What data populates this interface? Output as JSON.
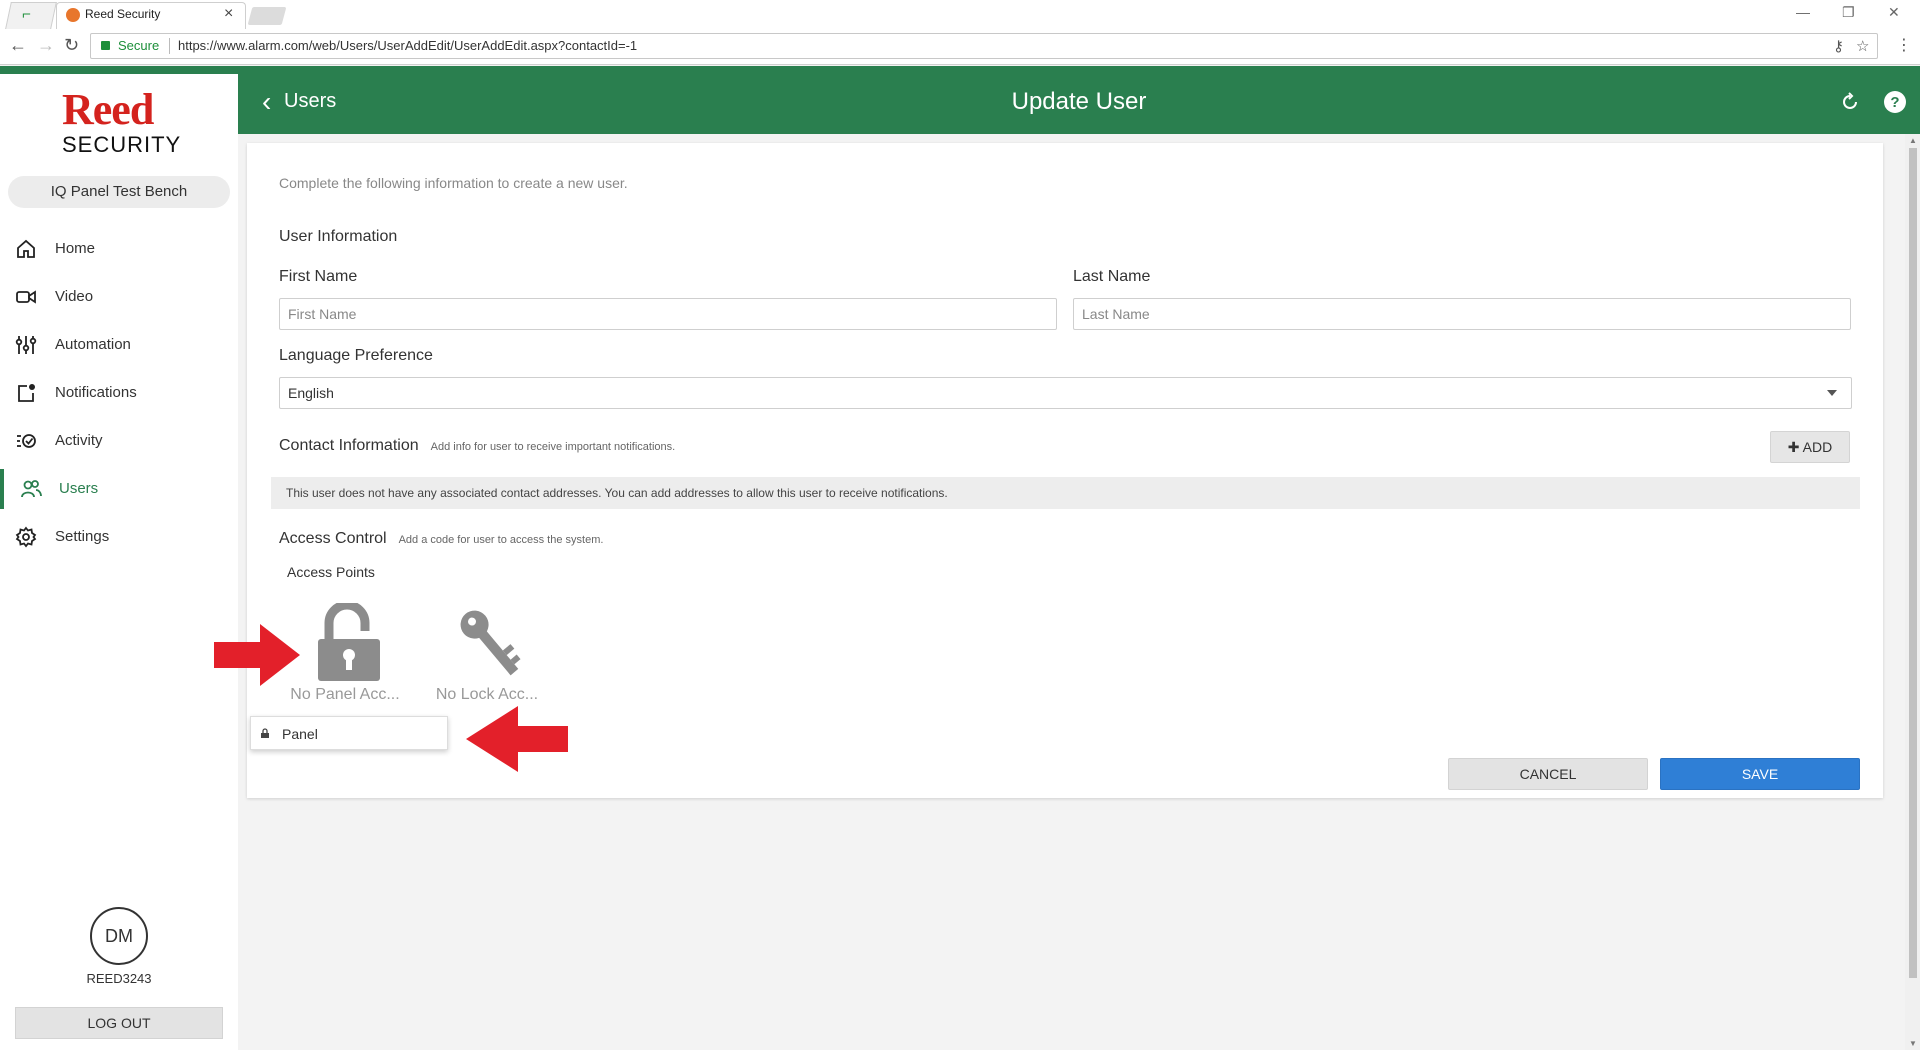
{
  "browser": {
    "tab_title": "Reed Security",
    "secure_label": "Secure",
    "url": "https://www.alarm.com/web/Users/UserAddEdit/UserAddEdit.aspx?contactId=-1"
  },
  "brand": {
    "logo_line1": "Reed",
    "logo_line2": "SECURITY",
    "accent": "#2a7f4f",
    "logo_red": "#d4231e",
    "save_blue": "#2f7fd6"
  },
  "sidebar": {
    "site_name": "IQ Panel Test Bench",
    "items": [
      {
        "label": "Home",
        "icon": "home-icon"
      },
      {
        "label": "Video",
        "icon": "video-camera-icon"
      },
      {
        "label": "Automation",
        "icon": "sliders-icon"
      },
      {
        "label": "Notifications",
        "icon": "notification-icon"
      },
      {
        "label": "Activity",
        "icon": "activity-icon"
      },
      {
        "label": "Users",
        "icon": "users-icon",
        "active": true
      },
      {
        "label": "Settings",
        "icon": "gear-icon"
      }
    ],
    "avatar_initials": "DM",
    "username": "REED3243",
    "logout_label": "LOG OUT"
  },
  "header": {
    "back_label": "Users",
    "title": "Update User"
  },
  "form": {
    "intro": "Complete the following information to create a new user.",
    "user_info_title": "User Information",
    "first_name_label": "First Name",
    "first_name_placeholder": "First Name",
    "last_name_label": "Last Name",
    "last_name_placeholder": "Last Name",
    "language_label": "Language Preference",
    "language_value": "English",
    "contact_title": "Contact Information",
    "contact_note": "Add info for user to receive important notifications.",
    "add_label": "ADD",
    "contact_empty": "This user does not have any associated contact addresses. You can add addresses to allow this user to receive notifications.",
    "access_title": "Access Control",
    "access_note": "Add a code for user to access the system.",
    "access_points_label": "Access Points",
    "access_points": [
      {
        "caption": "No Panel Acc...",
        "icon": "padlock-open-icon"
      },
      {
        "caption": "No Lock Acc...",
        "icon": "key-icon"
      }
    ],
    "dropdown_option": "Panel",
    "cancel_label": "CANCEL",
    "save_label": "SAVE"
  }
}
